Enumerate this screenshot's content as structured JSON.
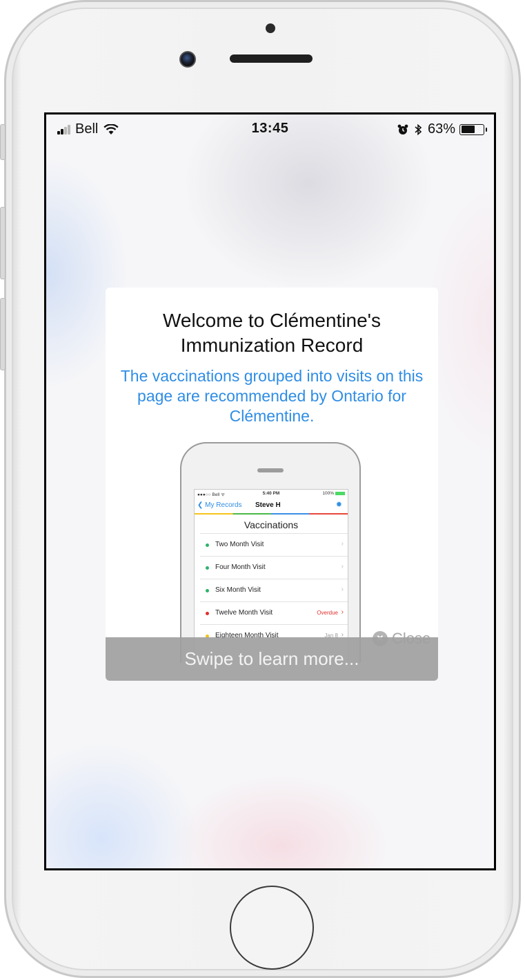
{
  "status_bar": {
    "carrier": "Bell",
    "time": "13:45",
    "battery": "63%",
    "battery_level": 0.63,
    "icons": [
      "signal-icon",
      "wifi-icon",
      "alarm-icon",
      "bluetooth-icon",
      "battery-icon"
    ]
  },
  "welcome": {
    "title": "Welcome to Clémentine's Immunization Record",
    "subtitle": "The vaccinations grouped into visits on this page are recommended by Ontario for Clémentine."
  },
  "illustration": {
    "status": {
      "carrier": "●●●○○ Bell ᯤ",
      "time": "5:40 PM",
      "battery": "100%"
    },
    "nav": {
      "back_label": "My Records",
      "title": "Steve H",
      "gear_icon": "gear-icon"
    },
    "heading": "Vaccinations",
    "rows": [
      {
        "label": "Two Month Visit",
        "status": "",
        "dot_color": "#2db36b"
      },
      {
        "label": "Four Month Visit",
        "status": "",
        "dot_color": "#2db36b"
      },
      {
        "label": "Six Month Visit",
        "status": "",
        "dot_color": "#2db36b"
      },
      {
        "label": "Twelve Month Visit",
        "status": "Overdue",
        "dot_color": "#e0312c",
        "status_color": "#e0312c"
      },
      {
        "label": "Eighteen Month Visit",
        "status": "Jan 8",
        "dot_color": "#f2c21b",
        "status_color": "#9a9a9a"
      }
    ]
  },
  "close_label": "Close",
  "swipe_label": "Swipe to learn more...",
  "colors": {
    "accent": "#2f8de4",
    "banner": "#a0a0a0",
    "overdue": "#e0312c"
  }
}
